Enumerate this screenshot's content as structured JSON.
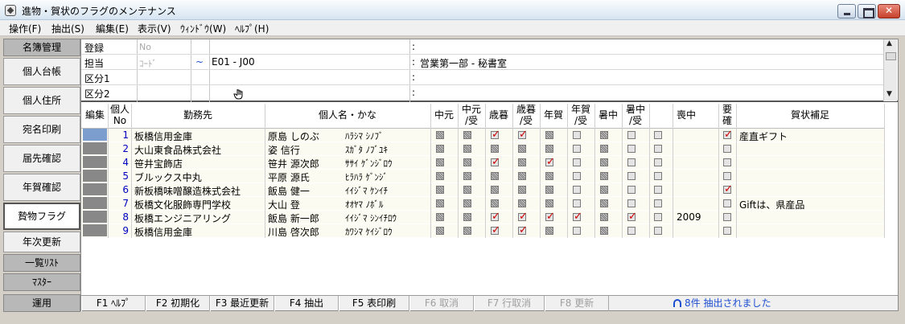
{
  "window": {
    "title": "進物・賀状のフラグのメンテナンス"
  },
  "menu": [
    "操作(F)",
    "抽出(S)",
    "編集(E)",
    "表示(V)",
    "ｳｨﾝﾄﾞｳ(W)",
    "ﾍﾙﾌﾟ(H)"
  ],
  "sidebar": [
    {
      "label": "名簿管理",
      "style": "dark"
    },
    {
      "label": "個人台帳",
      "style": "normal"
    },
    {
      "label": "個人住所",
      "style": "normal"
    },
    {
      "label": "宛名印刷",
      "style": "normal"
    },
    {
      "label": "届先確認",
      "style": "normal"
    },
    {
      "label": "年賀確認",
      "style": "normal"
    },
    {
      "label": "贄物フラグ",
      "style": "selected"
    },
    {
      "label": "年次更新",
      "style": "normal"
    },
    {
      "label": "一覧ﾘｽﾄ",
      "style": "dark"
    },
    {
      "label": "ﾏｽﾀｰ",
      "style": "dark"
    },
    {
      "label": "運用",
      "style": "dark"
    }
  ],
  "header": {
    "rows": [
      {
        "label": "登録",
        "ghost": "No",
        "code": "",
        "value": ""
      },
      {
        "label": "担当",
        "ghost": "ｺｰﾄﾞ",
        "code": "E01 - J00",
        "value": "営業第一部 - 秘書室"
      },
      {
        "label": "区分1",
        "ghost": "",
        "code": "",
        "value": ""
      },
      {
        "label": "区分2",
        "ghost": "",
        "code": "",
        "value": ""
      }
    ],
    "tilde": "~"
  },
  "columns": {
    "edit": "編集",
    "no": [
      "個人",
      "No"
    ],
    "company": "勤務先",
    "name": "個人名・かな",
    "chugen": "中元",
    "chugen_recv": [
      "中元",
      "/受"
    ],
    "seibo": "歳暮",
    "seibo_recv": [
      "歳暮",
      "/受"
    ],
    "nenga": "年賀",
    "nenga_recv": [
      "年賀",
      "/受"
    ],
    "shochu": "暑中",
    "shochu_recv": [
      "暑中",
      "/受"
    ],
    "mochu": "喪中",
    "yokaku": [
      "要",
      "確"
    ],
    "hosoku": "賀状補足"
  },
  "rows": [
    {
      "no": "1",
      "company": "板橋信用金庫",
      "name": "原島 しのぶ",
      "kana": "ﾊﾗｼﾏ ｼﾉﾌﾞ",
      "flags": [
        0,
        0,
        1,
        1,
        0,
        0,
        0,
        0
      ],
      "dark": [
        1,
        1,
        0,
        0,
        1,
        0,
        1,
        0
      ],
      "mochu": "",
      "yokaku": 1,
      "hosoku": "産直ギフト"
    },
    {
      "no": "2",
      "company": "大山東食品株式会社",
      "name": "姿 信行",
      "kana": "ｽｶﾞﾀ ﾉﾌﾞﾕｷ",
      "flags": [
        0,
        0,
        0,
        0,
        0,
        0,
        0,
        0
      ],
      "dark": [
        1,
        1,
        1,
        1,
        1,
        0,
        1,
        0
      ],
      "mochu": "",
      "yokaku": 0,
      "hosoku": ""
    },
    {
      "no": "4",
      "company": "笹井宝飾店",
      "name": "笹井 源次郎",
      "kana": "ｻｻｲ ｹﾞﾝｼﾞﾛｳ",
      "flags": [
        0,
        0,
        1,
        0,
        1,
        0,
        0,
        0
      ],
      "dark": [
        1,
        1,
        0,
        1,
        0,
        0,
        1,
        0
      ],
      "mochu": "",
      "yokaku": 0,
      "hosoku": ""
    },
    {
      "no": "5",
      "company": "ブルックス中丸",
      "name": "平原 源氏",
      "kana": "ﾋﾗﾊﾗ ｹﾞﾝｼﾞ",
      "flags": [
        0,
        0,
        0,
        0,
        0,
        0,
        0,
        0
      ],
      "dark": [
        1,
        1,
        1,
        1,
        1,
        0,
        1,
        0
      ],
      "mochu": "",
      "yokaku": 0,
      "hosoku": ""
    },
    {
      "no": "6",
      "company": "新板橋味噌醸造株式会社",
      "name": "飯島 健一",
      "kana": "ｲｲｼﾞﾏ ｹﾝｲﾁ",
      "flags": [
        0,
        0,
        0,
        0,
        0,
        0,
        0,
        0
      ],
      "dark": [
        1,
        1,
        1,
        1,
        1,
        0,
        1,
        0
      ],
      "mochu": "",
      "yokaku": 1,
      "hosoku": ""
    },
    {
      "no": "7",
      "company": "板橋文化服飾専門学校",
      "name": "大山 登",
      "kana": "ｵｵﾔﾏ ﾉﾎﾞﾙ",
      "flags": [
        0,
        0,
        0,
        0,
        0,
        0,
        0,
        0
      ],
      "dark": [
        1,
        1,
        1,
        1,
        1,
        0,
        1,
        0
      ],
      "mochu": "",
      "yokaku": 0,
      "hosoku": "Giftは、県産品"
    },
    {
      "no": "8",
      "company": "板橋エンジニアリング",
      "name": "飯島 新一郎",
      "kana": "ｲｲｼﾞﾏ ｼﾝｲﾁﾛｳ",
      "flags": [
        0,
        0,
        1,
        1,
        1,
        1,
        0,
        1
      ],
      "dark": [
        1,
        1,
        0,
        0,
        0,
        0,
        1,
        0
      ],
      "mochu": "2009",
      "yokaku": 0,
      "hosoku": ""
    },
    {
      "no": "9",
      "company": "板橋信用金庫",
      "name": "川島 啓次郎",
      "kana": "ｶﾜｼﾏ ｹｲｼﾞﾛｳ",
      "flags": [
        0,
        0,
        1,
        1,
        0,
        0,
        0,
        0
      ],
      "dark": [
        1,
        1,
        0,
        0,
        1,
        0,
        1,
        0
      ],
      "mochu": "",
      "yokaku": 0,
      "hosoku": ""
    }
  ],
  "fkeys": [
    {
      "label": "F1 ﾍﾙﾌﾟ",
      "enabled": true
    },
    {
      "label": "F2 初期化",
      "enabled": true
    },
    {
      "label": "F3 最近更新",
      "enabled": true
    },
    {
      "label": "F4 抽出",
      "enabled": true
    },
    {
      "label": "F5 表印刷",
      "enabled": true
    },
    {
      "label": "F6 取消",
      "enabled": false
    },
    {
      "label": "F7 行取消",
      "enabled": false
    },
    {
      "label": "F8 更新",
      "enabled": false
    }
  ],
  "status": {
    "text": "8件  抽出されました",
    "color": "#1e4fd1"
  },
  "colors": {
    "check": "#d00000",
    "no_text": "#0000c0",
    "selected_edit": "#7b9ecf"
  }
}
